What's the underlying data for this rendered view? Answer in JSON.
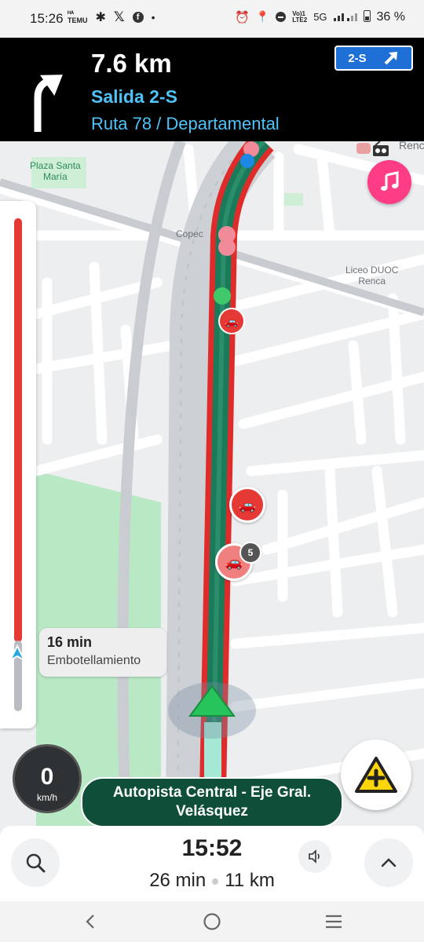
{
  "status_bar": {
    "time": "15:26",
    "left_icons": [
      "temu-icon",
      "bluetooth-icon",
      "x-icon",
      "facebook-icon",
      "dot-icon"
    ],
    "right_icons": [
      "alarm-icon",
      "location-icon",
      "dnd-icon",
      "volte-icon",
      "signal-icon",
      "battery-icon"
    ],
    "volte_top": "Vo)1",
    "volte_bottom": "LTE2",
    "network": "5G",
    "battery": "36 %"
  },
  "instruction": {
    "distance": "7.6 km",
    "exit": "Salida 2-S",
    "route": "Ruta 78 / Departamental",
    "sign": "2-S",
    "turn_icon": "turn-left-arrow-icon",
    "sign_icon": "arrow-up-right-icon"
  },
  "map": {
    "labels": {
      "plaza": "Plaza Santa\nMaría",
      "copec": "Copec",
      "liceo": "Liceo DUOC\nRenca",
      "renca": "Renc"
    },
    "alerts": [
      {
        "type": "traffic-jam",
        "count": null
      },
      {
        "type": "traffic-jam",
        "count": null
      },
      {
        "type": "traffic-jam",
        "count": "5"
      }
    ],
    "route_color": "#1b7a5a",
    "traffic_color": "#e53935"
  },
  "traffic_bar": {
    "delay": "16 min",
    "status": "Embotellamiento"
  },
  "speedometer": {
    "value": "0",
    "unit": "km/h"
  },
  "current_street": "Autopista Central - Eje Gral. Velásquez",
  "trip": {
    "eta": "15:52",
    "duration": "26 min",
    "distance": "11 km"
  },
  "colors": {
    "accent_blue": "#4fc3f7",
    "music_pink": "#ff3d86",
    "report_yellow": "#ffd60a",
    "street_green": "#0f4f3a"
  }
}
